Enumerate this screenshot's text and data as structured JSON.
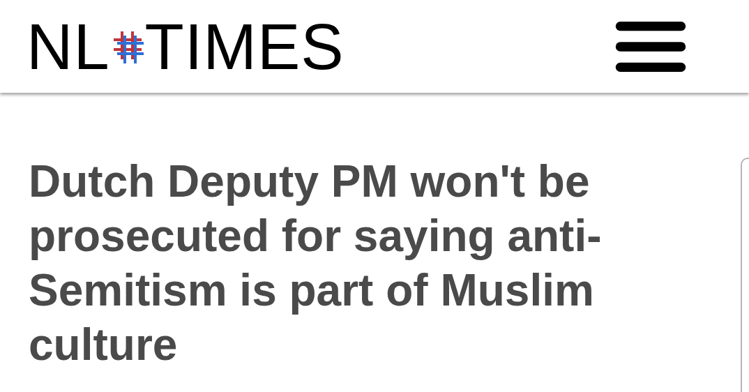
{
  "logo": {
    "left": "NL",
    "right": "TIMES"
  },
  "headline": "Dutch Deputy PM won't be prosecuted for saying anti-Semitism is part of Muslim culture"
}
